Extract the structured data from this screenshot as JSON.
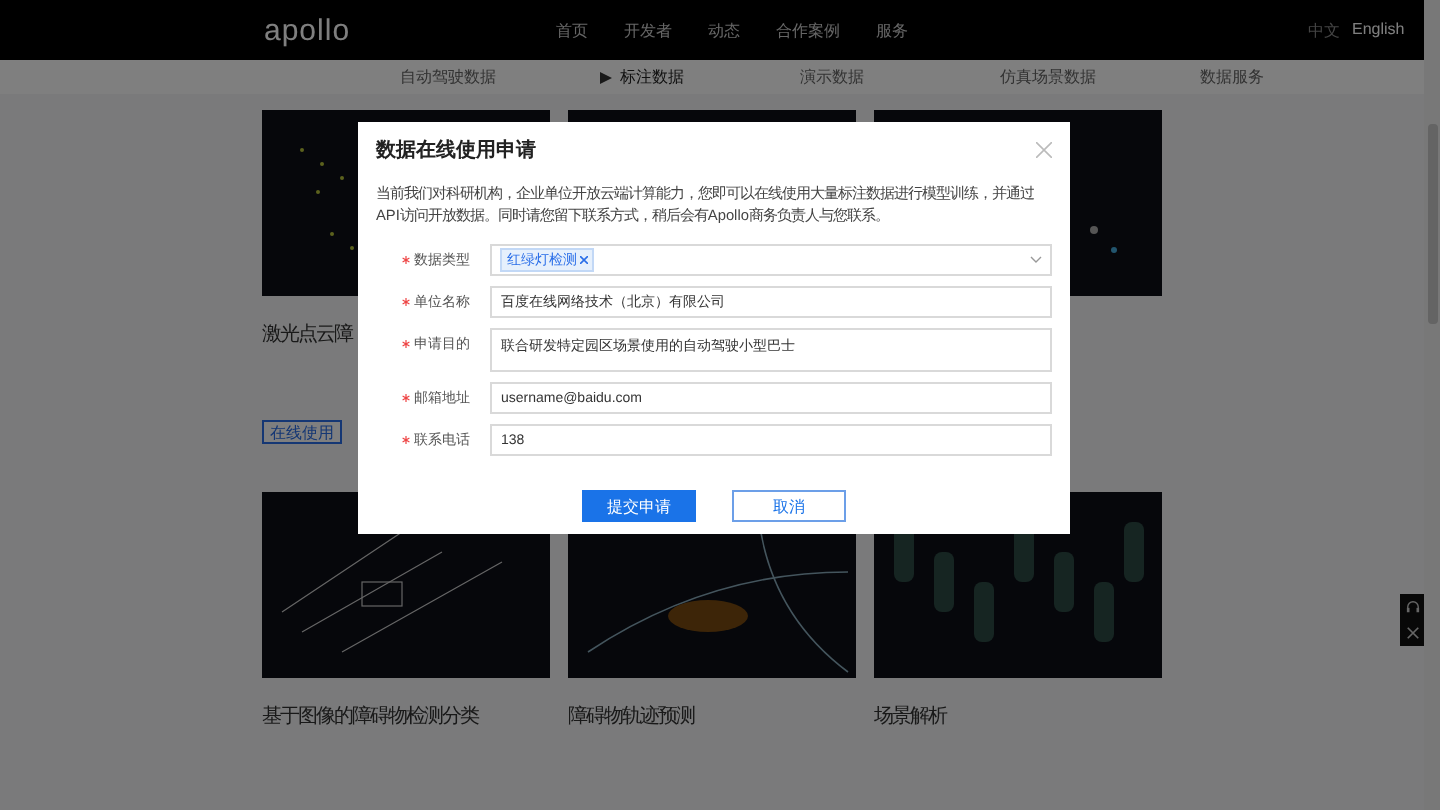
{
  "header": {
    "logo": "apollo",
    "nav": [
      {
        "label": "首页",
        "selected": false
      },
      {
        "label": "开发者",
        "selected": false
      },
      {
        "label": "动态",
        "selected": false
      },
      {
        "label": "合作案例",
        "selected": false
      },
      {
        "label": "服务",
        "selected": false
      }
    ],
    "languages": [
      {
        "label": "中文",
        "selected": false
      },
      {
        "label": "English",
        "selected": true
      }
    ]
  },
  "subnav": [
    {
      "label": "自动驾驶数据",
      "selected": false
    },
    {
      "label": "标注数据",
      "selected": true
    },
    {
      "label": "演示数据",
      "selected": false
    },
    {
      "label": "仿真场景数据",
      "selected": false
    },
    {
      "label": "数据服务",
      "selected": false
    }
  ],
  "cards": [
    {
      "kind": "points",
      "title": "激光点云障",
      "button": "在线使用"
    },
    {
      "kind": "city"
    },
    {
      "kind": "night"
    },
    {
      "kind": "crossing",
      "title": "基于图像的障碍物检测分类"
    },
    {
      "kind": "trajectory",
      "title": "障碍物轨迹预测"
    },
    {
      "kind": "buildings",
      "title": "场景解析"
    }
  ],
  "dialog": {
    "title": "数据在线使用申请",
    "intro": "当前我们对科研机构，企业单位开放云端计算能力，您即可以在线使用大量标注数据进行模型训练，并通过API访问开放数据。同时请您留下联系方式，稍后会有Apollo商务负责人与您联系。",
    "fields": [
      {
        "kind": "select",
        "label": "数据类型",
        "required": true,
        "tags": [
          "红绿灯检测"
        ]
      },
      {
        "kind": "text",
        "label": "单位名称",
        "required": true,
        "value": "百度在线网络技术（北京）有限公司"
      },
      {
        "kind": "textarea",
        "label": "申请目的",
        "required": true,
        "value": "联合研发特定园区场景使用的自动驾驶小型巴士"
      },
      {
        "kind": "text",
        "label": "邮箱地址",
        "required": true,
        "value": "username@baidu.com"
      },
      {
        "kind": "text",
        "label": "联系电话",
        "required": true,
        "value": "138"
      }
    ],
    "submit": "提交申请",
    "cancel": "取消"
  }
}
